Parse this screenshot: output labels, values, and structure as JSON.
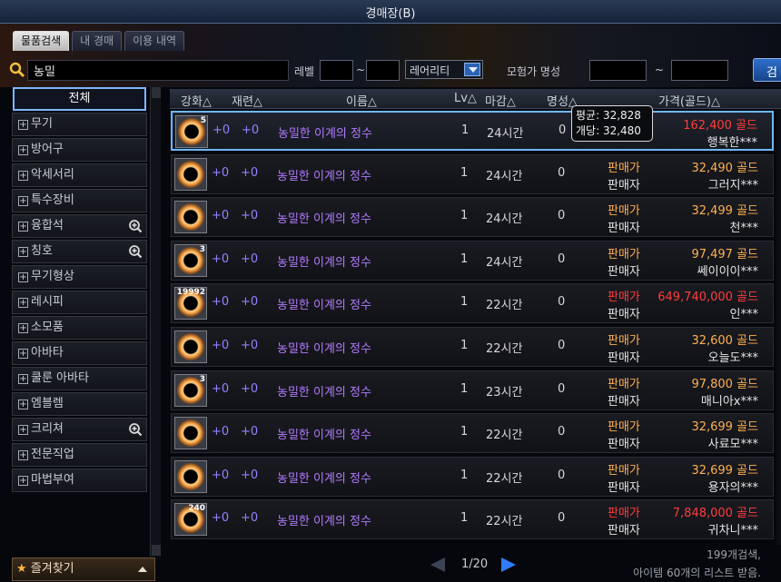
{
  "window": {
    "title": "경매장(B)"
  },
  "tabs": [
    {
      "label": "물품검색",
      "active": true
    },
    {
      "label": "내 경매",
      "active": false
    },
    {
      "label": "이용 내역",
      "active": false
    }
  ],
  "search": {
    "query": "농밀",
    "level_label": "레벨",
    "tilde": "~",
    "rarity_label": "레어리티",
    "adventurer_fame_label": "모험가 명성",
    "search_button": "검"
  },
  "sidebar": {
    "items": [
      {
        "label": "전체",
        "selected": true,
        "plus": false,
        "magnifier": false
      },
      {
        "label": "무기",
        "plus": true,
        "magnifier": false
      },
      {
        "label": "방어구",
        "plus": true,
        "magnifier": false
      },
      {
        "label": "악세서리",
        "plus": true,
        "magnifier": false
      },
      {
        "label": "특수장비",
        "plus": true,
        "magnifier": false
      },
      {
        "label": "융합석",
        "plus": true,
        "magnifier": true
      },
      {
        "label": "칭호",
        "plus": true,
        "magnifier": true
      },
      {
        "label": "무기형상",
        "plus": true,
        "magnifier": false
      },
      {
        "label": "레시피",
        "plus": true,
        "magnifier": false
      },
      {
        "label": "소모품",
        "plus": true,
        "magnifier": false
      },
      {
        "label": "아바타",
        "plus": true,
        "magnifier": false
      },
      {
        "label": "쿨룬 아바타",
        "plus": true,
        "magnifier": false
      },
      {
        "label": "엠블렘",
        "plus": true,
        "magnifier": false
      },
      {
        "label": "크리쳐",
        "plus": true,
        "magnifier": true
      },
      {
        "label": "전문직업",
        "plus": true,
        "magnifier": false
      },
      {
        "label": "마법부여",
        "plus": true,
        "magnifier": false
      }
    ],
    "favorites_label": "즐겨찾기"
  },
  "table": {
    "headers": {
      "enhance": "강화△",
      "refine": "재련△",
      "name": "이름△",
      "level": "Lv△",
      "expire": "마감△",
      "fame": "명성△",
      "price": "가격(골드)△"
    },
    "price_label": "판매가",
    "seller_label": "판매자",
    "rows": [
      {
        "stack": "5",
        "enhance": "+0",
        "refine": "+0",
        "name": "농밀한 이계의 정수",
        "level": "1",
        "expire": "24시간",
        "fame": "0",
        "price": "162,400 골드",
        "seller": "행복한***",
        "red": true,
        "selected": true
      },
      {
        "stack": "",
        "enhance": "+0",
        "refine": "+0",
        "name": "농밀한 이계의 정수",
        "level": "1",
        "expire": "24시간",
        "fame": "0",
        "price": "32,490 골드",
        "seller": "그러지***",
        "red": false
      },
      {
        "stack": "",
        "enhance": "+0",
        "refine": "+0",
        "name": "농밀한 이계의 정수",
        "level": "1",
        "expire": "24시간",
        "fame": "0",
        "price": "32,499 골드",
        "seller": "천***",
        "red": false
      },
      {
        "stack": "3",
        "enhance": "+0",
        "refine": "+0",
        "name": "농밀한 이계의 정수",
        "level": "1",
        "expire": "24시간",
        "fame": "0",
        "price": "97,497 골드",
        "seller": "쎄이이이***",
        "red": false
      },
      {
        "stack": "19992",
        "enhance": "+0",
        "refine": "+0",
        "name": "농밀한 이계의 정수",
        "level": "1",
        "expire": "22시간",
        "fame": "0",
        "price": "649,740,000 골드",
        "seller": "인***",
        "red": true
      },
      {
        "stack": "",
        "enhance": "+0",
        "refine": "+0",
        "name": "농밀한 이계의 정수",
        "level": "1",
        "expire": "22시간",
        "fame": "0",
        "price": "32,600 골드",
        "seller": "오늘도***",
        "red": false
      },
      {
        "stack": "3",
        "enhance": "+0",
        "refine": "+0",
        "name": "농밀한 이계의 정수",
        "level": "1",
        "expire": "23시간",
        "fame": "0",
        "price": "97,800 골드",
        "seller": "매니아x***",
        "red": false
      },
      {
        "stack": "",
        "enhance": "+0",
        "refine": "+0",
        "name": "농밀한 이계의 정수",
        "level": "1",
        "expire": "22시간",
        "fame": "0",
        "price": "32,699 골드",
        "seller": "사료모***",
        "red": false
      },
      {
        "stack": "",
        "enhance": "+0",
        "refine": "+0",
        "name": "농밀한 이계의 정수",
        "level": "1",
        "expire": "22시간",
        "fame": "0",
        "price": "32,699 골드",
        "seller": "용자의***",
        "red": false
      },
      {
        "stack": "240",
        "enhance": "+0",
        "refine": "+0",
        "name": "농밀한 이계의 정수",
        "level": "1",
        "expire": "22시간",
        "fame": "0",
        "price": "7,848,000 골드",
        "seller": "귀차니***",
        "red": true
      }
    ]
  },
  "tooltip": {
    "line1": "평균: 32,828",
    "line2": "개당: 32,480"
  },
  "pager": {
    "page": "1/20"
  },
  "footer": {
    "result_count": "199개검색,",
    "list_info": "아이템 60개의 리스트 받음."
  },
  "colors": {
    "accent": "#6fb8ff",
    "price": "#ffb050",
    "price_high": "#ff3d3d",
    "item_name": "#b37aff"
  }
}
